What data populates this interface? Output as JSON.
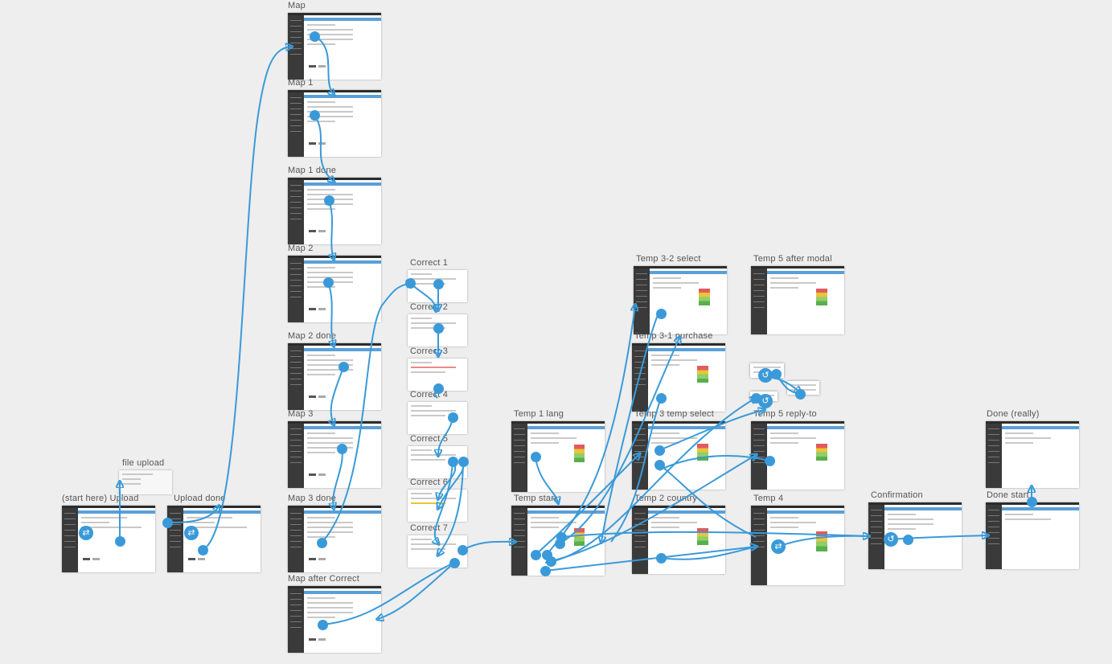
{
  "canvas": {
    "background": "#eeeeee",
    "link_color": "#3a9ad9"
  },
  "artboards": {
    "start": "(start here) Upload",
    "file_upload": "file upload",
    "upload_done": "Upload done",
    "map": "Map",
    "map1": "Map 1",
    "map1_done": "Map 1 done",
    "map2": "Map 2",
    "map2_done": "Map 2 done",
    "map3": "Map 3",
    "map3_done": "Map 3 done",
    "map_after_correct": "Map after Correct",
    "correct1": "Correct 1",
    "correct2": "Correct 2",
    "correct3": "Correct 3",
    "correct4": "Correct 4",
    "correct5": "Correct 5",
    "correct6": "Correct 6",
    "correct7": "Correct 7",
    "temp1_lang": "Temp 1 lang",
    "temp_start": "Temp start",
    "temp2_country": "Temp 2 country",
    "temp3_2_select": "Temp 3-2 select",
    "temp3_purchase": "Temp 3-1 purchase",
    "temp3_temp_select": "Temp 3 temp select",
    "temp4": "Temp 4",
    "temp5_after_modal": "Temp 5  after modal",
    "temp5_reply_to": "Temp 5  reply-to",
    "confirmation": "Confirmation",
    "done_start": "Done start",
    "done_really": "Done (really)"
  },
  "icons": {
    "hotspot": "hotspot-dot",
    "link_icon": "link-icon",
    "back_icon": "back-icon"
  }
}
